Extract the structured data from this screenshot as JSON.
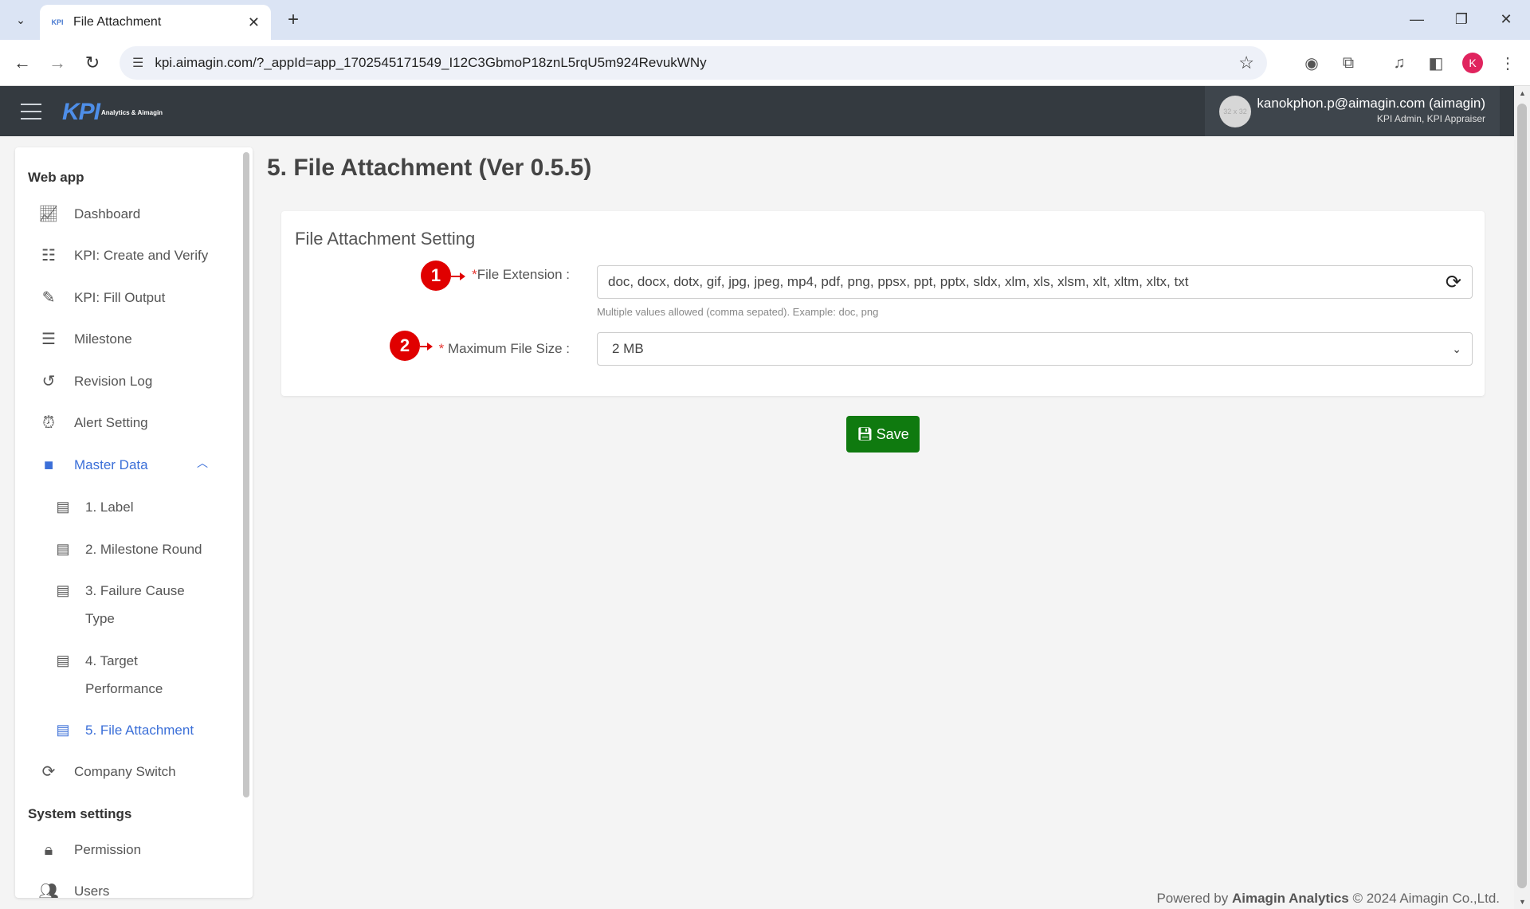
{
  "browser": {
    "tab_title": "File Attachment",
    "tab_favicon": "KPI",
    "url": "kpi.aimagin.com/?_appId=app_1702545171549_I12C3GbmoP18znL5rqU5m924RevukWNy",
    "profile_initial": "K"
  },
  "header": {
    "logo_text": "KPI",
    "logo_sub": "Analytics & Aimagin",
    "avatar_text": "32 x 32",
    "user_name": "kanokphon.p@aimagin.com (aimagin)",
    "user_roles": "KPI Admin, KPI Appraiser"
  },
  "sidebar": {
    "section_webapp": "Web app",
    "items": [
      {
        "label": "Dashboard",
        "icon": "chart-line-icon"
      },
      {
        "label": "KPI: Create and Verify",
        "icon": "checklist-icon"
      },
      {
        "label": "KPI: Fill Output",
        "icon": "edit-icon"
      },
      {
        "label": "Milestone",
        "icon": "list-tree-icon"
      },
      {
        "label": "Revision Log",
        "icon": "history-icon"
      },
      {
        "label": "Alert Setting",
        "icon": "alarm-clock-icon"
      },
      {
        "label": "Master Data",
        "icon": "folder-icon"
      },
      {
        "label": "Company Switch",
        "icon": "sync-icon"
      }
    ],
    "sub_items": [
      {
        "label": "1. Label"
      },
      {
        "label": "2. Milestone Round"
      },
      {
        "label": "3. Failure Cause Type"
      },
      {
        "label": "4. Target Performance"
      },
      {
        "label": "5. File Attachment"
      }
    ],
    "section_system": "System settings",
    "system_items": [
      {
        "label": "Permission",
        "icon": "lock-icon"
      },
      {
        "label": "Users",
        "icon": "users-icon"
      }
    ]
  },
  "main": {
    "title": "5. File Attachment (Ver 0.5.5)",
    "card_title": "File Attachment Setting",
    "file_ext_label": "File Extension :",
    "file_ext_value": "doc, docx, dotx, gif, jpg, jpeg, mp4, pdf, png, ppsx, ppt, pptx, sldx, xlm, xls, xlsm, xlt, xltm, xltx, txt",
    "file_ext_hint": "Multiple values allowed (comma sepated). Example: doc, png",
    "max_size_label": "Maximum File Size :",
    "max_size_value": "2 MB",
    "required_mark": "*",
    "badge_1": "1",
    "badge_2": "2",
    "save_label": "Save"
  },
  "footer": {
    "powered_by": "Powered by",
    "brand": "Aimagin Analytics",
    "copyright": "© 2024 Aimagin Co.,Ltd."
  }
}
